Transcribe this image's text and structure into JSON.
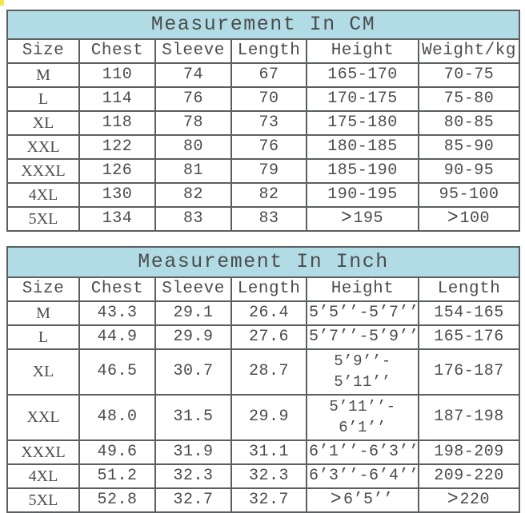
{
  "tables": [
    {
      "id": "cm",
      "title": "Measurement In CM",
      "columns": [
        "Size",
        "Chest",
        "Sleeve",
        "Length",
        "Height",
        "Weight/kg"
      ],
      "rows": [
        {
          "size": "M",
          "chest": "110",
          "sleeve": "74",
          "length": "67",
          "height": "165-170",
          "last": "70-75"
        },
        {
          "size": "L",
          "chest": "114",
          "sleeve": "76",
          "length": "70",
          "height": "170-175",
          "last": "75-80"
        },
        {
          "size": "XL",
          "chest": "118",
          "sleeve": "78",
          "length": "73",
          "height": "175-180",
          "last": "80-85"
        },
        {
          "size": "XXL",
          "chest": "122",
          "sleeve": "80",
          "length": "76",
          "height": "180-185",
          "last": "85-90"
        },
        {
          "size": "XXXL",
          "chest": "126",
          "sleeve": "81",
          "length": "79",
          "height": "185-190",
          "last": "90-95"
        },
        {
          "size": "4XL",
          "chest": "130",
          "sleeve": "82",
          "length": "82",
          "height": "190-195",
          "last": "95-100"
        },
        {
          "size": "5XL",
          "chest": "134",
          "sleeve": "83",
          "length": "83",
          "height": "〉195",
          "last": "〉100"
        }
      ]
    },
    {
      "id": "inch",
      "title": "Measurement In Inch",
      "columns": [
        "Size",
        "Chest",
        "Sleeve",
        "Length",
        "Height",
        "Length"
      ],
      "rows": [
        {
          "size": "M",
          "chest": "43.3",
          "sleeve": "29.1",
          "length": "26.4",
          "height": "5’5’’-5’7’’",
          "last": "154-165"
        },
        {
          "size": "L",
          "chest": "44.9",
          "sleeve": "29.9",
          "length": "27.6",
          "height": "5’7’’-5’9’’",
          "last": "165-176"
        },
        {
          "size": "XL",
          "chest": "46.5",
          "sleeve": "30.7",
          "length": "28.7",
          "height": "5’9’’-\n5’11’’",
          "last": "176-187",
          "tall": true
        },
        {
          "size": "XXL",
          "chest": "48.0",
          "sleeve": "31.5",
          "length": "29.9",
          "height": "5’11’’-\n6’1’’",
          "last": "187-198",
          "tall": true
        },
        {
          "size": "XXXL",
          "chest": "49.6",
          "sleeve": "31.9",
          "length": "31.1",
          "height": "6’1’’-6’3’’",
          "last": "198-209"
        },
        {
          "size": "4XL",
          "chest": "51.2",
          "sleeve": "32.3",
          "length": "32.3",
          "height": "6’3’’-6’4’’",
          "last": "209-220"
        },
        {
          "size": "5XL",
          "chest": "52.8",
          "sleeve": "32.7",
          "length": "32.7",
          "height": "〉6’5’’",
          "last": "〉220"
        }
      ]
    }
  ],
  "colors": {
    "title_band": "#b2dce5",
    "border": "#5b5f60",
    "text": "#4c4c4c",
    "corner_mark": "#f2e74b"
  }
}
